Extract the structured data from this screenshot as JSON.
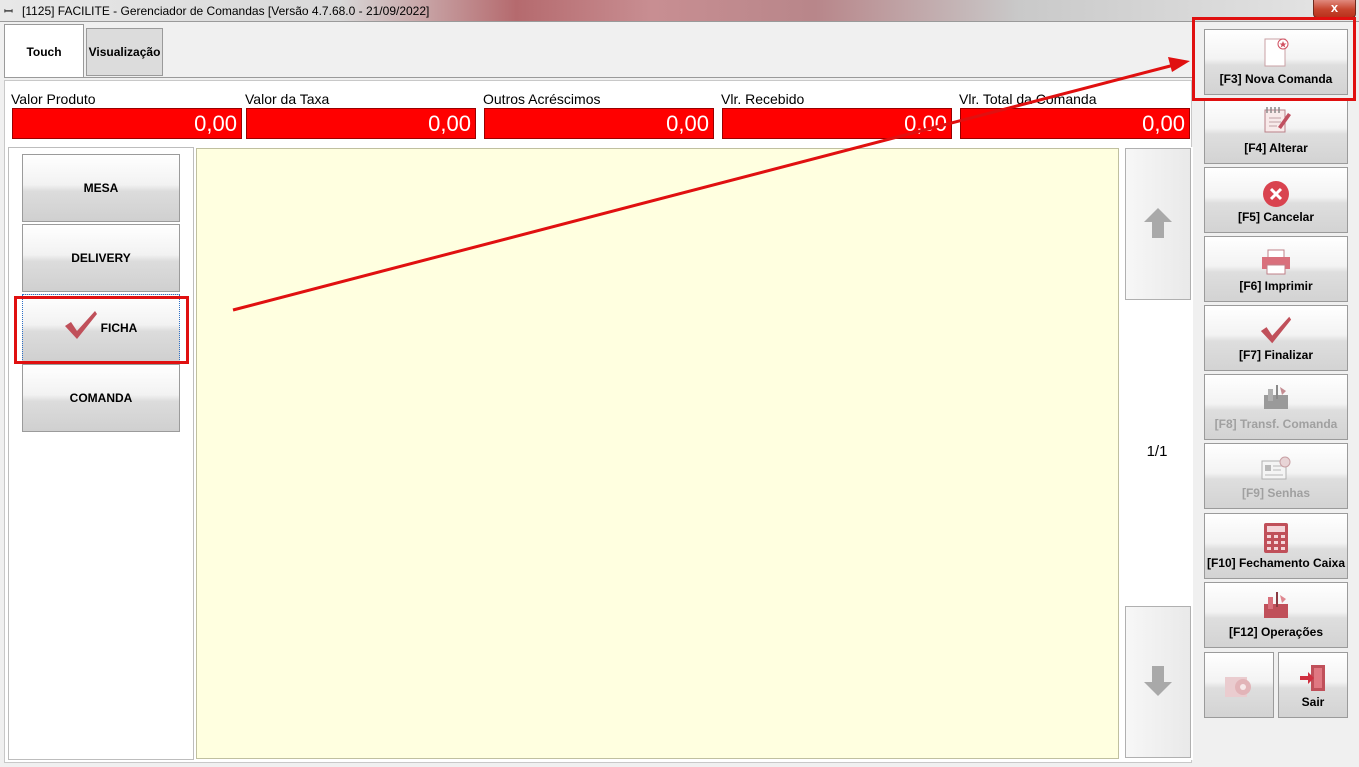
{
  "window": {
    "title": "[1125] FACILITE - Gerenciador de Comandas [Versão 4.7.68.0 - 21/09/2022]",
    "close_label": "x"
  },
  "tabs": [
    {
      "label": "Touch",
      "active": true
    },
    {
      "label": "Visualização",
      "active": false
    }
  ],
  "totals": [
    {
      "label": "Valor Produto",
      "value": "0,00"
    },
    {
      "label": "Valor da Taxa",
      "value": "0,00"
    },
    {
      "label": "Outros Acréscimos",
      "value": "0,00"
    },
    {
      "label": "Vlr. Recebido",
      "value": "0,00"
    },
    {
      "label": "Vlr. Total da Comanda",
      "value": "0,00"
    }
  ],
  "categories": [
    {
      "label": "MESA",
      "selected": false
    },
    {
      "label": "DELIVERY",
      "selected": false
    },
    {
      "label": "FICHA",
      "selected": true
    },
    {
      "label": "COMANDA",
      "selected": false
    }
  ],
  "pager": {
    "indicator": "1/1"
  },
  "actions": [
    {
      "label": "[F3] Nova Comanda",
      "icon": "new-document-icon",
      "enabled": true
    },
    {
      "label": "[F4] Alterar",
      "icon": "edit-notepad-icon",
      "enabled": true
    },
    {
      "label": "[F5] Cancelar",
      "icon": "cancel-icon",
      "enabled": true
    },
    {
      "label": "[F6] Imprimir",
      "icon": "printer-icon",
      "enabled": true
    },
    {
      "label": "[F7] Finalizar",
      "icon": "checkmark-icon",
      "enabled": true
    },
    {
      "label": "[F8] Transf. Comanda",
      "icon": "transfer-tools-icon",
      "enabled": false
    },
    {
      "label": "[F9] Senhas",
      "icon": "password-card-icon",
      "enabled": false
    },
    {
      "label": "[F10] Fechamento Caixa",
      "icon": "calculator-icon",
      "enabled": true
    },
    {
      "label": "[F12] Operações",
      "icon": "tools-icon",
      "enabled": true
    }
  ],
  "bottom_buttons": [
    {
      "label": "",
      "icon": "settings-gear-icon",
      "enabled": false
    },
    {
      "label": "Sair",
      "icon": "exit-door-icon",
      "enabled": true
    }
  ],
  "colors": {
    "total_box": "#ff0000",
    "main_area": "#ffffe0",
    "annotation": "#e01010"
  }
}
